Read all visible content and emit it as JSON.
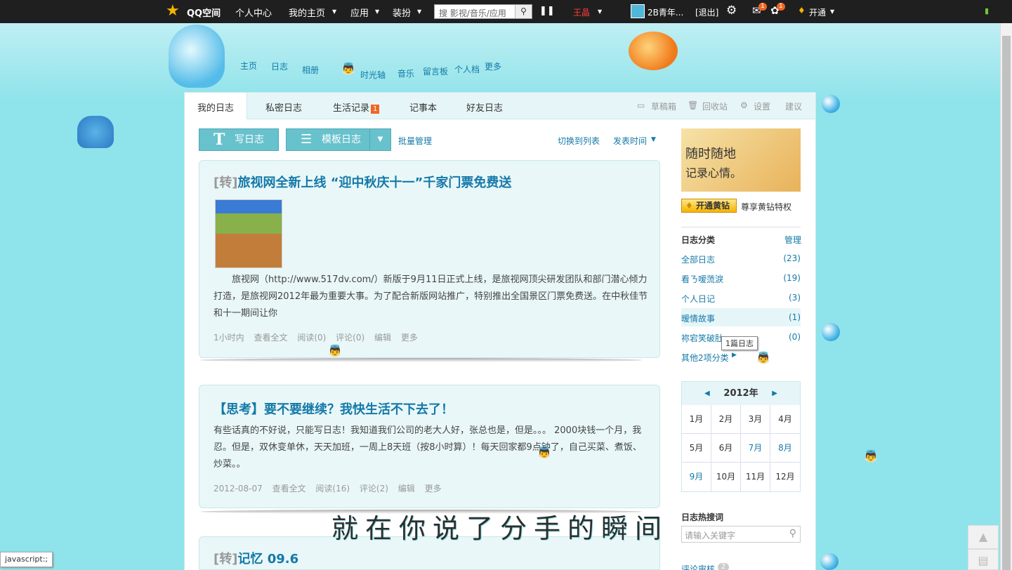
{
  "topbar": {
    "logo": "QQ空间",
    "personal_center": "个人中心",
    "my_home": "我的主页",
    "apps": "应用",
    "decorate": "装扮",
    "search_placeholder": "搜 影视/音乐/应用",
    "user_red": "王晶",
    "username": "2B青年...",
    "logout": "[退出]",
    "mail_badge": "1",
    "clover_badge": "1",
    "open_service": "开通"
  },
  "nav": [
    "主页",
    "日志",
    "相册",
    "时光轴",
    "音乐",
    "留言板",
    "个人档",
    "更多"
  ],
  "tabs": {
    "my_blog": "我的日志",
    "private_blog": "私密日志",
    "life_record": "生活记录",
    "life_badge": "1",
    "notebook": "记事本",
    "friends_blog": "好友日志"
  },
  "tools": {
    "drafts": "草稿箱",
    "recycle": "回收站",
    "settings": "设置",
    "suggest": "建议"
  },
  "actions": {
    "write": "写日志",
    "template": "模板日志",
    "batch": "批量管理",
    "switch_list": "切换到列表",
    "publish_time": "发表时间"
  },
  "posts": [
    {
      "tag": "[转]",
      "title": "旅视网全新上线 “迎中秋庆十一”千家门票免费送",
      "text": "旅视网（http://www.517dv.com/）新版于9月11日正式上线，是旅视网顶尖研发团队和部门潜心倾力打造，是旅视网2012年最为重要大事。为了配合新版网站推广，特别推出全国景区门票免费送。在中秋佳节和十一期间让你",
      "time": "1小时内",
      "view": "查看全文",
      "read": "阅读(0)",
      "comment": "评论(0)",
      "edit": "编辑",
      "more": "更多"
    },
    {
      "tag": "",
      "title": "【思考】要不要继续？我快生活不下去了！",
      "text": "有些话真的不好说，只能写日志！我知道我们公司的老大人好，张总也是，但是。。。 2000块钱一个月，我忍。但是，双休变单休，天天加班，一周上8天班（按8小时算）！每天回家都9点钟了，自己买菜、煮饭、炒菜。。",
      "time": "2012-08-07",
      "view": "查看全文",
      "read": "阅读(16)",
      "comment": "评论(2)",
      "edit": "编辑",
      "more": "更多"
    },
    {
      "tag": "[转]",
      "title": "记忆 09.6"
    }
  ],
  "sidebar": {
    "promo_line1": "随时随地",
    "promo_line2": "记录心情。",
    "vip_button": "开通黄钻",
    "vip_text": "尊享黄钻特权",
    "category_title": "日志分类",
    "manage": "管理",
    "categories": [
      {
        "name": "全部日志",
        "count": "(23)"
      },
      {
        "name": "看ㄋ嗳蓅淚",
        "count": "(19)"
      },
      {
        "name": "个人日记",
        "count": "(3)"
      },
      {
        "name": "暧情故事",
        "count": "(1)"
      },
      {
        "name": "祢宕笑破肚",
        "count": "(0)"
      }
    ],
    "tooltip": "1篇日志",
    "other": "其他2项分类",
    "year": "2012年",
    "months": [
      "1月",
      "2月",
      "3月",
      "4月",
      "5月",
      "6月",
      "7月",
      "8月",
      "9月",
      "10月",
      "11月",
      "12月"
    ],
    "hot_search": "日志热搜词",
    "keyword_placeholder": "请输入关键字",
    "review": "评论审核",
    "review_count": "2"
  },
  "status_text": "javascript:;",
  "deco_text": "就在你说了分手的瞬间"
}
